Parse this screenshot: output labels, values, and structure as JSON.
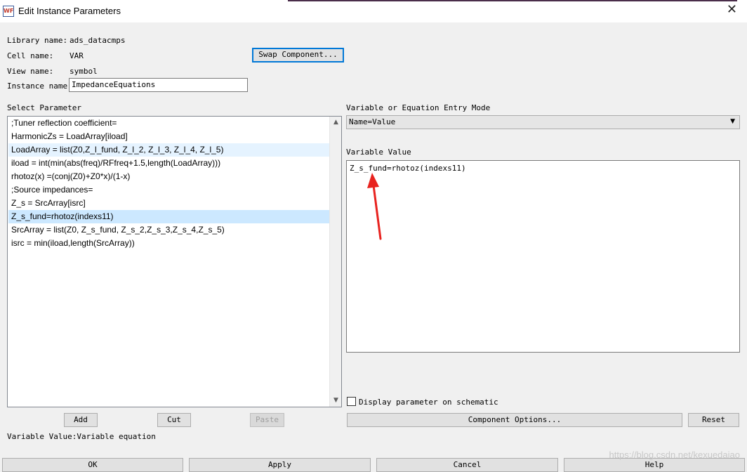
{
  "window": {
    "title": "Edit Instance Parameters",
    "icon_text": "WF",
    "close_glyph": "✕"
  },
  "fields": {
    "library_label": "Library name:",
    "library_value": "ads_datacmps",
    "cell_label": "Cell name:",
    "cell_value": "VAR",
    "view_label": "View name:",
    "view_value": "symbol",
    "instance_label": "Instance name:",
    "instance_value": "ImpedanceEquations"
  },
  "buttons": {
    "swap": "Swap Component...",
    "add": "Add",
    "cut": "Cut",
    "paste": "Paste",
    "component_options": "Component Options...",
    "reset": "Reset",
    "ok": "OK",
    "apply": "Apply",
    "cancel": "Cancel",
    "help": "Help"
  },
  "select_parameter": {
    "label": "Select Parameter",
    "items": [
      ";Tuner reflection coefficient=",
      "HarmonicZs = LoadArray[iload]",
      "LoadArray = list(Z0,Z_l_fund, Z_l_2, Z_l_3, Z_l_4, Z_l_5)",
      "iload = int(min(abs(freq)/RFfreq+1.5,length(LoadArray)))",
      "rhotoz(x) =(conj(Z0)+Z0*x)/(1-x)",
      ";Source impedances=",
      "Z_s = SrcArray[isrc]",
      "Z_s_fund=rhotoz(indexs11)",
      "SrcArray = list(Z0, Z_s_fund, Z_s_2,Z_s_3,Z_s_4,Z_s_5)",
      "isrc = min(iload,length(SrcArray))"
    ],
    "selected_index": 7
  },
  "entry_mode": {
    "label": "Variable or Equation Entry Mode",
    "selected": "Name=Value"
  },
  "variable_value": {
    "label": "Variable Value",
    "text": "Z_s_fund=rhotoz(indexs11)"
  },
  "display_checkbox": {
    "label": "Display parameter on schematic",
    "checked": false
  },
  "status": {
    "text": "Variable Value:Variable equation"
  },
  "watermark": "https://blog.csdn.net/kexuedaiao",
  "colors": {
    "selection": "#cce8ff",
    "annotation_arrow": "#e8231f"
  },
  "icons": {
    "scroll_up": "▲",
    "scroll_down": "▼",
    "dropdown": "▼"
  }
}
